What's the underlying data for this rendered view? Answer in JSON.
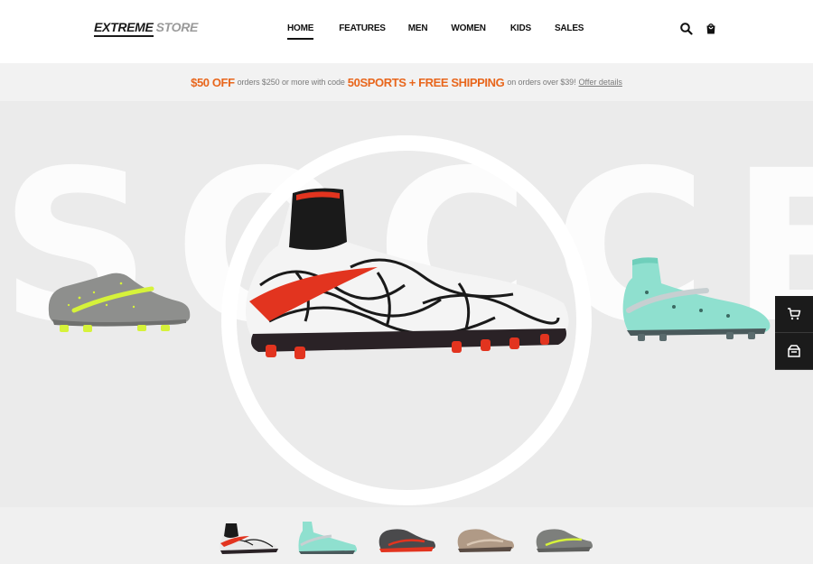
{
  "header": {
    "logo_primary": "EXTREME",
    "logo_secondary": "STORE",
    "nav": [
      "HOME",
      "FEATURES",
      "MEN",
      "WOMEN",
      "KIDS",
      "SALES"
    ],
    "active_nav": "HOME"
  },
  "promo": {
    "offer": "$50 OFF",
    "text1": "orders $250 or more with code",
    "code_and_shipping": "50SPORTS + FREE SHIPPING",
    "text2": "on orders over $39!",
    "link": "Offer details"
  },
  "hero": {
    "watermark": "SOCCER"
  },
  "colors": {
    "accent": "#e8661c",
    "dark": "#1b1b1b",
    "hero_bg": "#ebebeb"
  },
  "icons": {
    "search": "search-icon",
    "bag": "shopping-bag-icon",
    "cart": "cart-icon",
    "box": "open-box-icon"
  }
}
